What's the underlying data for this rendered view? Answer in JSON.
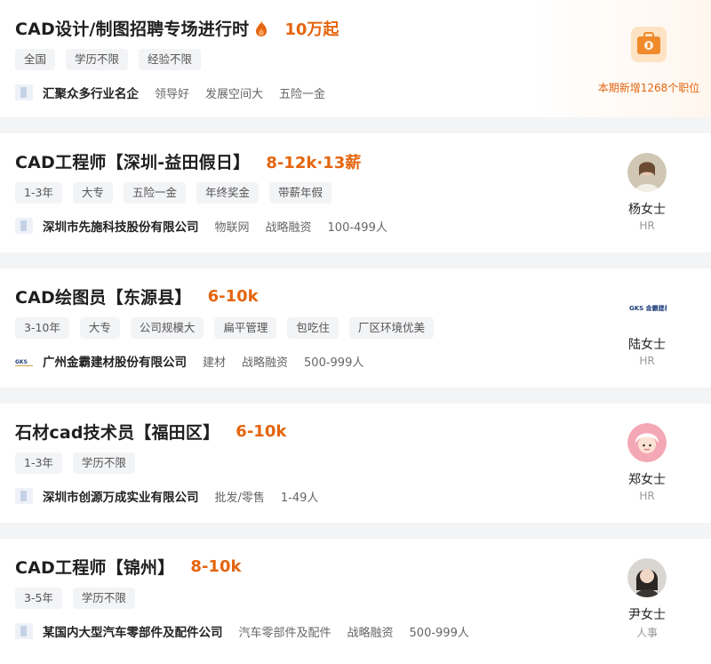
{
  "jobs": [
    {
      "title": "CAD设计/制图招聘专场进行时",
      "salary": "10万起",
      "tags": [
        "全国",
        "学历不限",
        "经验不限"
      ],
      "company": "汇聚众多行业名企",
      "meta": [
        "领导好",
        "发展空间大",
        "五险一金"
      ],
      "promo_text": "本期新增1268个职位"
    },
    {
      "title": "CAD工程师【深圳-益田假日】",
      "salary": "8-12k·13薪",
      "tags": [
        "1-3年",
        "大专",
        "五险一金",
        "年终奖金",
        "带薪年假"
      ],
      "company": "深圳市先施科技股份有限公司",
      "meta": [
        "物联网",
        "战略融资",
        "100-499人"
      ],
      "hr_name": "杨女士",
      "hr_role": "HR"
    },
    {
      "title": "CAD绘图员【东源县】",
      "salary": "6-10k",
      "tags": [
        "3-10年",
        "大专",
        "公司规模大",
        "扁平管理",
        "包吃住",
        "厂区环境优美"
      ],
      "company": "广州金霸建材股份有限公司",
      "meta": [
        "建材",
        "战略融资",
        "500-999人"
      ],
      "hr_name": "陆女士",
      "hr_role": "HR",
      "hr_logo_text": "GKS 金霸建材",
      "company_logo_text": "GKS"
    },
    {
      "title": "石材cad技术员【福田区】",
      "salary": "6-10k",
      "tags": [
        "1-3年",
        "学历不限"
      ],
      "company": "深圳市创源万成实业有限公司",
      "meta": [
        "批发/零售",
        "1-49人"
      ],
      "hr_name": "郑女士",
      "hr_role": "HR"
    },
    {
      "title": "CAD工程师【锦州】",
      "salary": "8-10k",
      "tags": [
        "3-5年",
        "学历不限"
      ],
      "company": "某国内大型汽车零部件及配件公司",
      "meta": [
        "汽车零部件及配件",
        "战略融资",
        "500-999人"
      ],
      "hr_name": "尹女士",
      "hr_role": "人事"
    }
  ],
  "colors": {
    "accent": "#e4650f",
    "tag_bg": "#f3f4f6",
    "page_bg": "#f3f4f6"
  }
}
